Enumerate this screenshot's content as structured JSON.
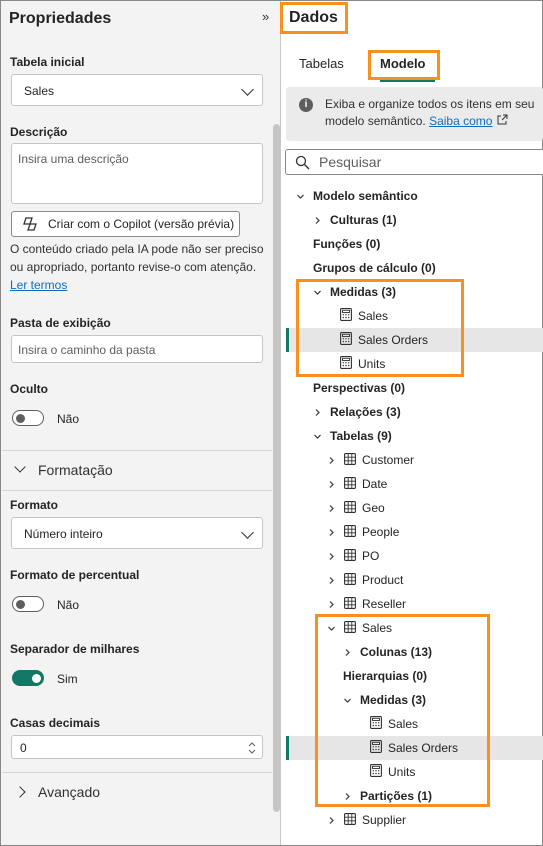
{
  "left_pane": {
    "title": "Propriedades",
    "collapse_glyph": "»",
    "initial_table": {
      "label": "Tabela inicial",
      "value": "Sales"
    },
    "description": {
      "label": "Descrição",
      "placeholder": "Insira uma descrição"
    },
    "copilot_button": "Criar com o Copilot (versão prévia)",
    "ai_note": "O conteúdo criado pela IA pode não ser preciso ou apropriado, portanto revise-o com atenção.",
    "ai_note_link": "Ler termos",
    "display_folder": {
      "label": "Pasta de exibição",
      "placeholder": "Insira o caminho da pasta"
    },
    "hidden": {
      "label": "Oculto",
      "state": "Não"
    },
    "formatting_section": "Formatação",
    "format": {
      "label": "Formato",
      "value": "Número inteiro"
    },
    "percent_format": {
      "label": "Formato de percentual",
      "state": "Não"
    },
    "thousands_separator": {
      "label": "Separador de milhares",
      "state": "Sim"
    },
    "decimal_places": {
      "label": "Casas decimais",
      "value": "0"
    },
    "advanced_section": "Avançado"
  },
  "right_pane": {
    "title": "Dados",
    "tabs": [
      "Tabelas",
      "Modelo"
    ],
    "active_tab": "Modelo",
    "info_text": "Exiba e organize todos os itens em seu modelo semântico.",
    "info_link": "Saiba como",
    "search_placeholder": "Pesquisar",
    "tree": {
      "root": "Modelo semântico",
      "cultures": "Culturas (1)",
      "functions": "Funções (0)",
      "calc_groups": "Grupos de cálculo (0)",
      "measures": "Medidas (3)",
      "measure_items": [
        "Sales",
        "Sales Orders",
        "Units"
      ],
      "perspectives": "Perspectivas (0)",
      "relationships": "Relações (3)",
      "tables": "Tabelas (9)",
      "table_items": [
        "Customer",
        "Date",
        "Geo",
        "People",
        "PO",
        "Product",
        "Reseller",
        "Sales",
        "Supplier"
      ],
      "sales_children": {
        "columns": "Colunas (13)",
        "hierarchies": "Hierarquias (0)",
        "measures": "Medidas (3)",
        "measure_items": [
          "Sales",
          "Sales Orders",
          "Units"
        ],
        "partitions": "Partições (1)"
      }
    }
  },
  "colors": {
    "accent": "#117865",
    "highlight": "#f7901e",
    "link": "#0f6cbd"
  }
}
